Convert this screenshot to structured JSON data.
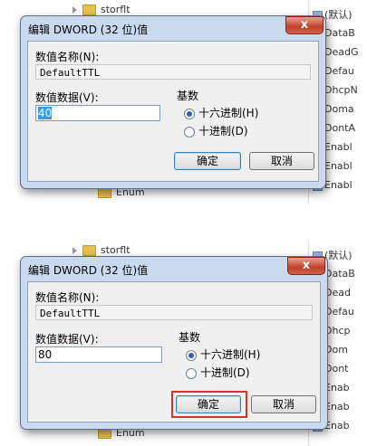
{
  "panels": [
    {
      "tree": [
        {
          "label": "storflt",
          "kind": "arrow"
        },
        {
          "label": "Enum",
          "kind": "folder"
        }
      ],
      "values": [
        "(默认)",
        "DataB",
        "DeadG",
        "Defau",
        "DhcpN",
        "Doma",
        "DontA",
        "Enabl",
        "Enabl",
        "Enabl"
      ],
      "dialog": {
        "title": "编辑 DWORD (32 位)值",
        "close": "x",
        "name_label": "数值名称(N):",
        "name_value": "DefaultTTL",
        "data_label": "数值数据(V):",
        "data_value": "40",
        "base_label": "基数",
        "hex_label": "十六进制(H)",
        "dec_label": "十进制(D)",
        "selected_base": "hex",
        "ok": "确定",
        "cancel": "取消"
      }
    },
    {
      "tree": [
        {
          "label": "storflt",
          "kind": "arrow"
        },
        {
          "label": "Enum",
          "kind": "folder"
        }
      ],
      "values": [
        "(默认)",
        "DataB",
        "Dead",
        "Defau",
        "Dhcp",
        "Dom",
        "Dont",
        "Enab",
        "Enab",
        "Enab"
      ],
      "dialog": {
        "title": "编辑 DWORD (32 位)值",
        "close": "x",
        "name_label": "数值名称(N):",
        "name_value": "DefaultTTL",
        "data_label": "数值数据(V):",
        "data_value": "80",
        "base_label": "基数",
        "hex_label": "十六进制(H)",
        "dec_label": "十进制(D)",
        "selected_base": "hex",
        "ok": "确定",
        "cancel": "取消"
      }
    }
  ],
  "colors": {
    "highlight": "#d9302a",
    "dialog_frame": "#c9d9ee"
  }
}
